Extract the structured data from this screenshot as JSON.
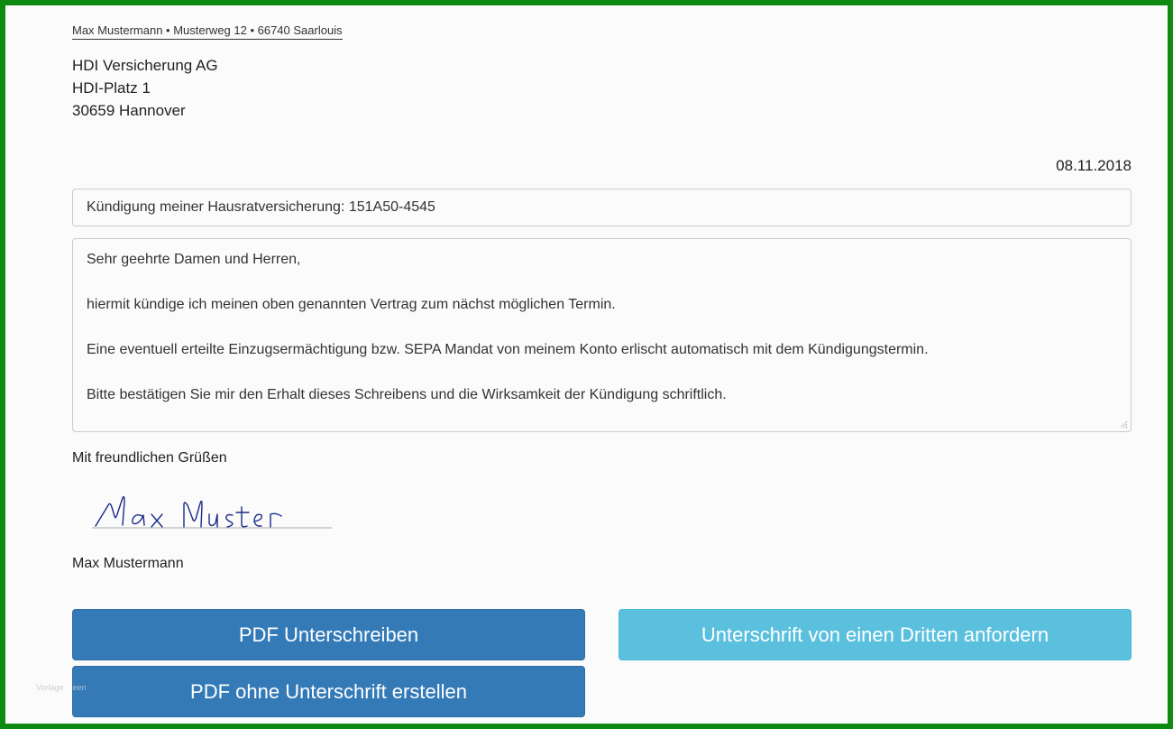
{
  "letter": {
    "sender_line": "Max Mustermann • Musterweg 12 • 66740 Saarlouis",
    "recipient": {
      "company": "HDI Versicherung AG",
      "street": "HDI-Platz 1",
      "city": "30659 Hannover"
    },
    "date": "08.11.2018",
    "subject": "Kündigung meiner Hausratversicherung: 151A50-4545",
    "body": {
      "salutation": "Sehr geehrte Damen und Herren,",
      "paragraph_1": "hiermit kündige ich meinen oben genannten Vertrag zum nächst möglichen Termin.",
      "paragraph_2": "Eine eventuell erteilte Einzugsermächtigung bzw. SEPA Mandat von meinem Konto erlischt automatisch mit dem Kündigungstermin.",
      "paragraph_3": "Bitte bestätigen Sie mir den Erhalt dieses Schreibens und die Wirksamkeit der Kündigung schriftlich."
    },
    "closing": "Mit freundlichen Grüßen",
    "signature_text": "Max Muster",
    "signer_name": "Max Mustermann"
  },
  "actions": {
    "sign_pdf": "PDF Unterschreiben",
    "request_third_party": "Unterschrift von einen Dritten anfordern",
    "pdf_without_signature": "PDF ohne Unterschrift erstellen"
  },
  "watermark": {
    "text_a": "Vorlage",
    "text_b": "Ideen"
  },
  "colors": {
    "frame": "#0e8a12",
    "primary_button": "#337ab7",
    "info_button": "#5bc0de",
    "signature_ink": "#1a2a8a"
  }
}
